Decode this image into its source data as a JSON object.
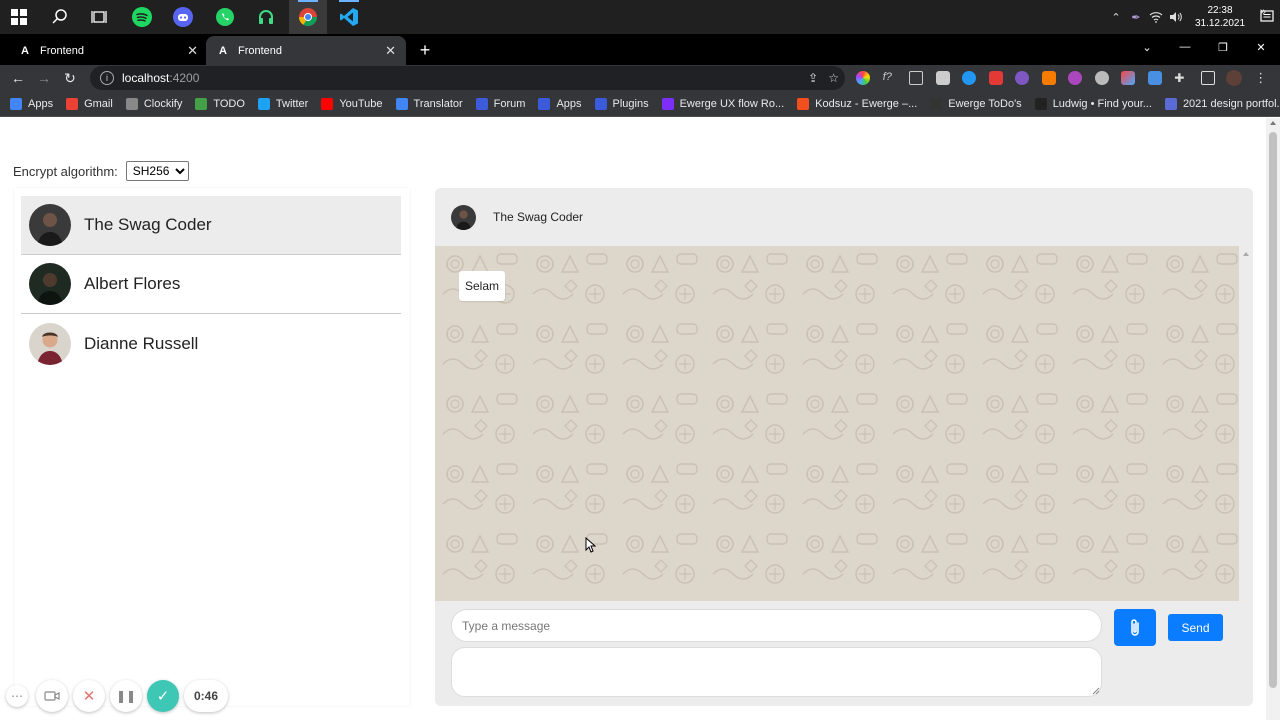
{
  "taskbar": {
    "apps": [
      "windows-start",
      "search",
      "task-view",
      "spotify",
      "discord",
      "whatsapp",
      "headset-app",
      "chrome",
      "vscode"
    ],
    "time": "22:38",
    "date": "31.12.2021"
  },
  "browser": {
    "tabs": [
      {
        "title": "Frontend",
        "active": false
      },
      {
        "title": "Frontend",
        "active": true
      }
    ],
    "url_host": "localhost",
    "url_port": ":4200",
    "bookmarks": [
      {
        "label": "Apps",
        "icon": "apps-grid-icon",
        "color": "#4285f4"
      },
      {
        "label": "Gmail",
        "icon": "gmail-icon",
        "color": "#ea4335"
      },
      {
        "label": "Clockify",
        "icon": "clockify-icon",
        "color": "#888888"
      },
      {
        "label": "TODO",
        "icon": "todo-check-icon",
        "color": "#43a047"
      },
      {
        "label": "Twitter",
        "icon": "twitter-icon",
        "color": "#1da1f2"
      },
      {
        "label": "YouTube",
        "icon": "youtube-icon",
        "color": "#ff0000"
      },
      {
        "label": "Translator",
        "icon": "translator-icon",
        "color": "#4285f4"
      },
      {
        "label": "Forum",
        "icon": "forum-icon",
        "color": "#3b5bdb"
      },
      {
        "label": "Apps",
        "icon": "apps-icon",
        "color": "#3b5bdb"
      },
      {
        "label": "Plugins",
        "icon": "plugins-icon",
        "color": "#3b5bdb"
      },
      {
        "label": "Ewerge UX flow Ro...",
        "icon": "ewerge-icon",
        "color": "#7b2ff7"
      },
      {
        "label": "Kodsuz - Ewerge –...",
        "icon": "figma-icon",
        "color": "#f24e1e"
      },
      {
        "label": "Ewerge ToDo's",
        "icon": "notion-icon",
        "color": "#333333"
      },
      {
        "label": "Ludwig • Find your...",
        "icon": "ludwig-icon",
        "color": "#222222"
      },
      {
        "label": "2021 design portfol...",
        "icon": "word-icon",
        "color": "#5b6bd5"
      }
    ],
    "bookmarks_more": "»"
  },
  "page": {
    "algo_label": "Encrypt algorithm:",
    "algo_selected": "SH256",
    "contacts": [
      {
        "name": "The Swag Coder",
        "active": true
      },
      {
        "name": "Albert Flores",
        "active": false
      },
      {
        "name": "Dianne Russell",
        "active": false
      }
    ],
    "chat": {
      "header_name": "The Swag Coder",
      "messages": [
        {
          "text": "Selam"
        }
      ],
      "input_placeholder": "Type a message",
      "send_label": "Send"
    }
  },
  "recorder": {
    "elapsed": "0:46"
  },
  "colors": {
    "accent": "#0a7cff",
    "chat_bg": "#ddd6cb",
    "panel_bg": "#ececec",
    "recorder_done": "#3ec7b5"
  }
}
